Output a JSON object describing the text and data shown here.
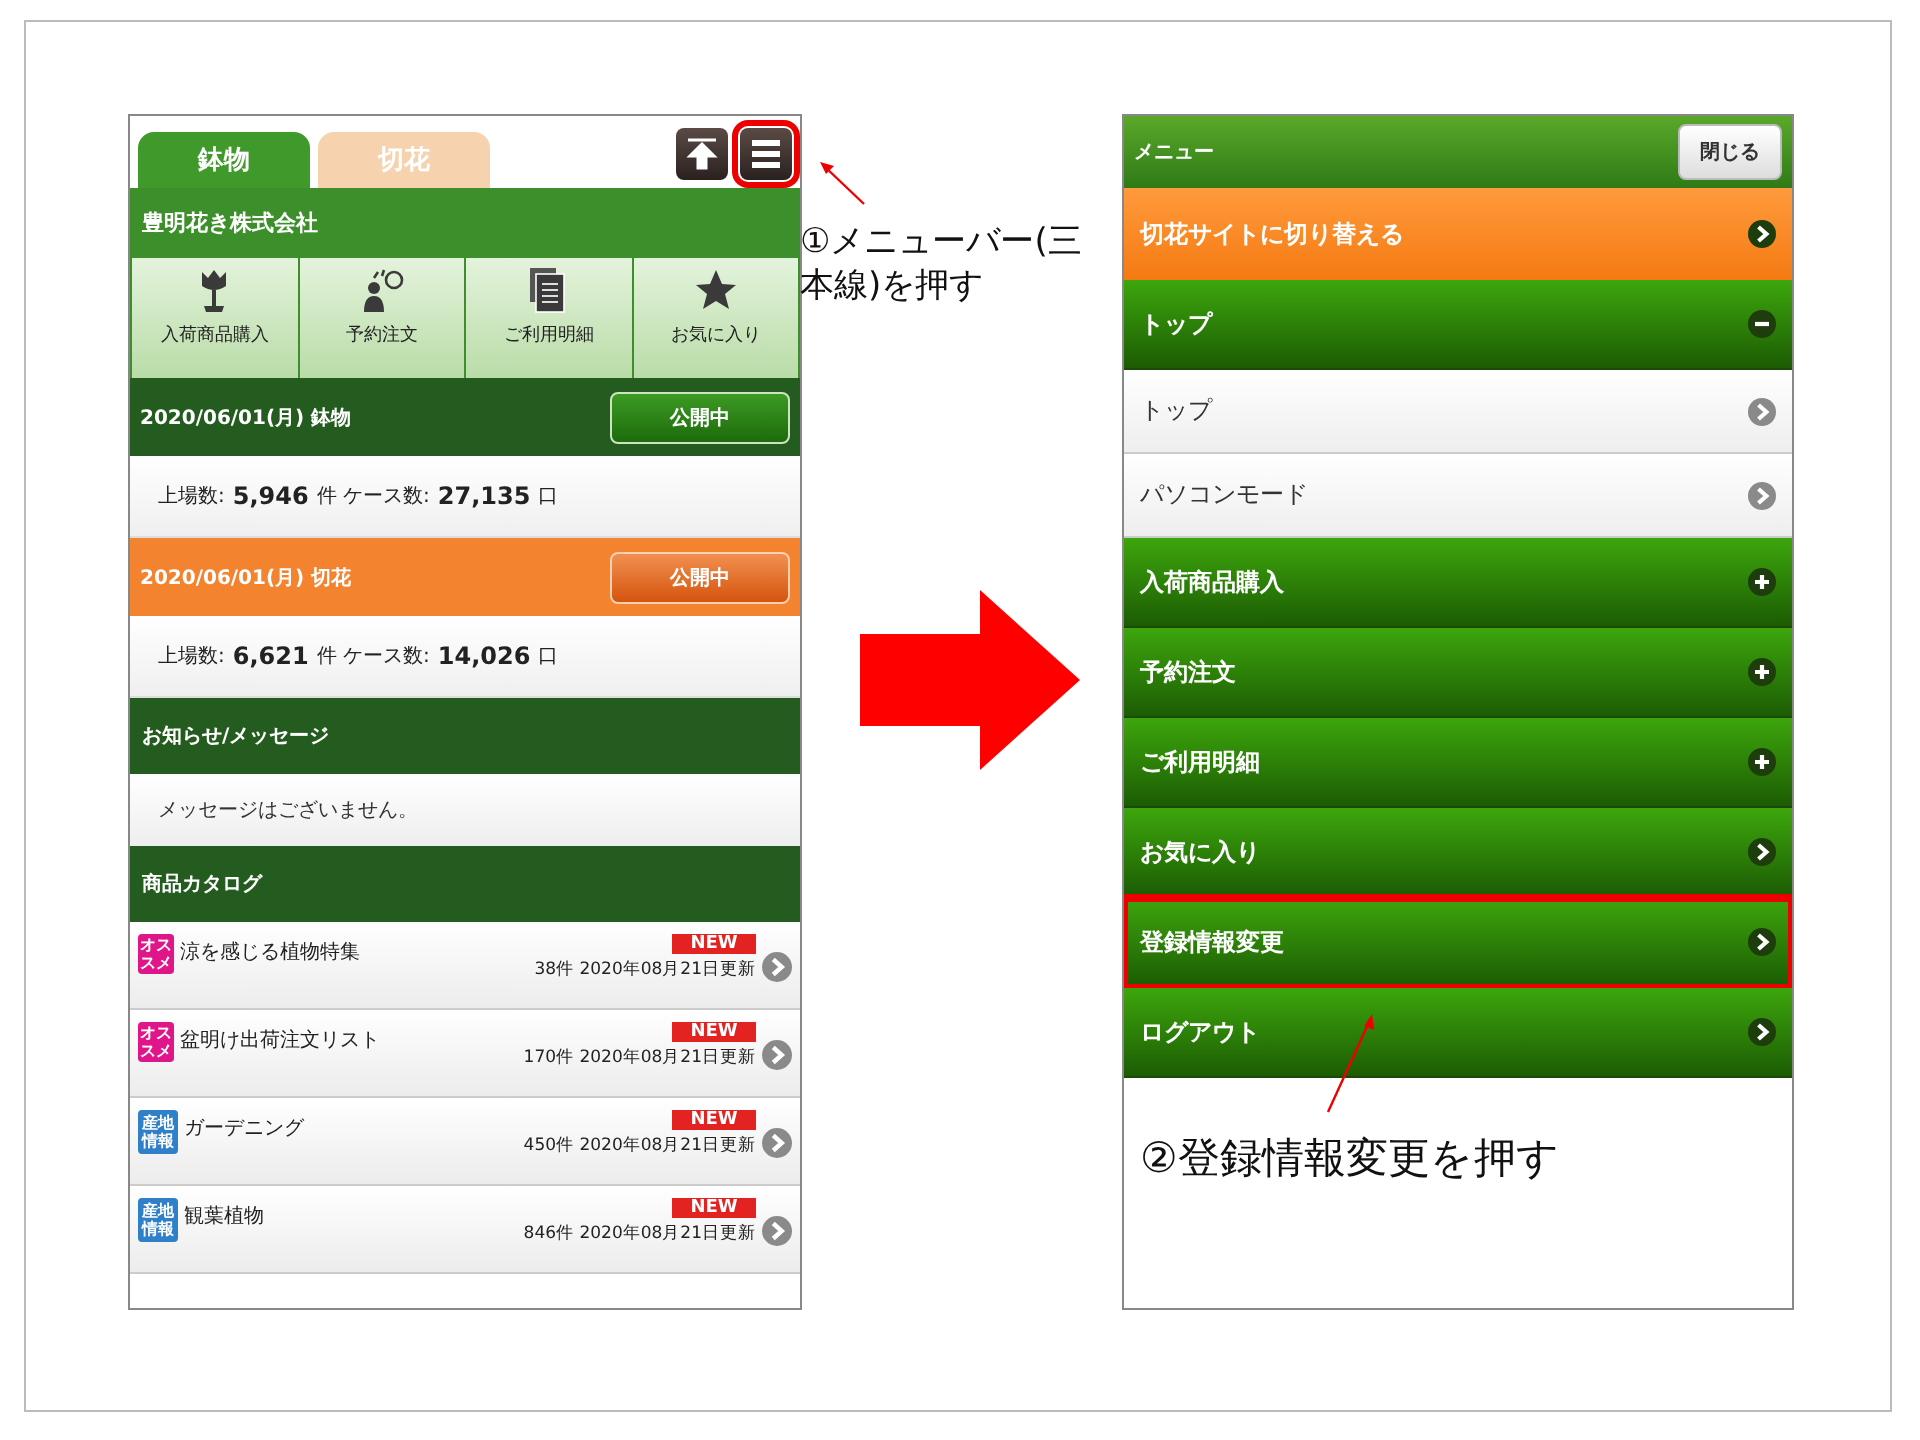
{
  "left_phone": {
    "tabs": [
      {
        "label": "鉢物",
        "selected": true
      },
      {
        "label": "切花",
        "selected": false
      }
    ],
    "menu_button_highlighted": true,
    "company": "豊明花き株式会社",
    "shortcuts": [
      {
        "label": "入荷商品購入",
        "kind": "tulip"
      },
      {
        "label": "予約注文",
        "kind": "reserve"
      },
      {
        "label": "ご利用明細",
        "kind": "documents"
      },
      {
        "label": "お気に入り",
        "kind": "star"
      }
    ],
    "markets": [
      {
        "date": "2020/06/01(月) 鉢物",
        "status": "公開中",
        "kind": "potted",
        "stats": "上場数: **5,946** 件 ケース数: **27,135** 口"
      },
      {
        "date": "2020/06/01(月) 切花",
        "status": "公開中",
        "kind": "cut",
        "stats": "上場数: **6,621** 件 ケース数: **14,026** 口"
      }
    ],
    "notices": {
      "title": "お知らせ/メッセージ",
      "message": "メッセージはございません。"
    },
    "catalog": {
      "title": "商品カタログ",
      "items": [
        {
          "badge": "オススメ",
          "kind": "recommended",
          "title": "涼を感じる植物特集",
          "flag": "NEW",
          "count": "38件",
          "updated": "2020年08月21日更新"
        },
        {
          "badge": "オススメ",
          "kind": "recommended",
          "title": "盆明け出荷注文リスト",
          "flag": "NEW",
          "count": "170件",
          "updated": "2020年08月21日更新"
        },
        {
          "badge": "産地情報",
          "kind": "origin",
          "title": "ガーデニング",
          "flag": "NEW",
          "count": "450件",
          "updated": "2020年08月21日更新"
        },
        {
          "badge": "産地情報",
          "kind": "origin",
          "title": "観葉植物",
          "flag": "NEW",
          "count": "846件",
          "updated": "2020年08月21日更新"
        }
      ]
    }
  },
  "right_phone": {
    "title": "メニュー",
    "close": "閉じる",
    "items": [
      {
        "label": "切花サイトに切り替える",
        "kind": "switch",
        "highlighted": false
      },
      {
        "label": "トップ",
        "kind": "section",
        "expanded": true,
        "highlighted": false
      },
      {
        "label": "トップ",
        "kind": "link",
        "highlighted": false
      },
      {
        "label": "パソコンモード",
        "kind": "link",
        "highlighted": false
      },
      {
        "label": "入荷商品購入",
        "kind": "section",
        "expanded": false,
        "highlighted": false
      },
      {
        "label": "予約注文",
        "kind": "section",
        "expanded": false,
        "highlighted": false
      },
      {
        "label": "ご利用明細",
        "kind": "section",
        "expanded": false,
        "highlighted": false
      },
      {
        "label": "お気に入り",
        "kind": "action",
        "highlighted": false
      },
      {
        "label": "登録情報変更",
        "kind": "action",
        "highlighted": true
      },
      {
        "label": "ログアウト",
        "kind": "action",
        "highlighted": false
      }
    ]
  },
  "annotations": [
    {
      "text": "①メニューバー(三本線)を押す"
    },
    {
      "text": "②登録情報変更を押す"
    }
  ]
}
